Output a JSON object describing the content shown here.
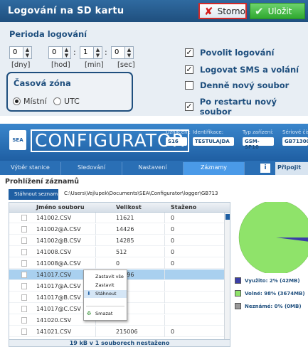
{
  "dialog": {
    "title": "Logování na SD kartu",
    "cancel_label": "Storno",
    "save_label": "Uložit",
    "period_label": "Perioda logování",
    "spinners": [
      {
        "value": "0",
        "unit": "[dny]"
      },
      {
        "value": "0",
        "unit": "[hod]"
      },
      {
        "value": "1",
        "unit": "[min]"
      },
      {
        "value": "0",
        "unit": "[sec]"
      }
    ],
    "timezone_label": "Časová zóna",
    "timezone_options": [
      {
        "label": "Místní",
        "selected": true
      },
      {
        "label": "UTC",
        "selected": false
      }
    ],
    "checkboxes": [
      {
        "label": "Povolit logování",
        "checked": true
      },
      {
        "label": "Logovat SMS a volání",
        "checked": true
      },
      {
        "label": "Denně nový soubor",
        "checked": false
      },
      {
        "label": "Po restartu nový soubor",
        "checked": true
      }
    ],
    "colors": {
      "header": "#2f6aa0",
      "accent": "#1f4f7e",
      "cancel_border": "#d12a2a",
      "save_bg": "#2fa82f"
    }
  },
  "configurator": {
    "logo_text": "SEA",
    "brand": "CONFIGURATOR",
    "header_fields": [
      {
        "label": "Označení:",
        "value": "S16"
      },
      {
        "label": "Identifikace:",
        "value": "TESTULAJDA"
      },
      {
        "label": "Typ zařízení:",
        "value": "GSM-SP10"
      },
      {
        "label": "Sériové čís",
        "value": "GB713006"
      }
    ],
    "nav_tabs": [
      {
        "label": "Výběr stanice",
        "active": false
      },
      {
        "label": "Sledování",
        "active": false
      },
      {
        "label": "Nastavení",
        "active": false
      },
      {
        "label": "Záznamy",
        "active": true
      }
    ],
    "info_icon": "i",
    "connect_label": "Připojit",
    "section_title": "Prohlížení záznamů",
    "download_list_label": "Stáhnout seznam",
    "path": "C:\\Users\\Vejlupek\\Documents\\SEA\\Configurator\\logger\\GB713",
    "table": {
      "headers": [
        "Jméno souboru",
        "Velikost",
        "Staženo"
      ],
      "rows": [
        {
          "name": "141002.CSV",
          "size": "11621",
          "downloaded": "0",
          "selected": false
        },
        {
          "name": "141002@A.CSV",
          "size": "14426",
          "downloaded": "0",
          "selected": false
        },
        {
          "name": "141002@B.CSV",
          "size": "14285",
          "downloaded": "0",
          "selected": false
        },
        {
          "name": "141008.CSV",
          "size": "512",
          "downloaded": "0",
          "selected": false
        },
        {
          "name": "141008@A.CSV",
          "size": "0",
          "downloaded": "0",
          "selected": false
        },
        {
          "name": "141017.CSV",
          "size": "18796",
          "downloaded": "",
          "selected": true
        },
        {
          "name": "141017@A.CSV",
          "size": "",
          "downloaded": "",
          "selected": false
        },
        {
          "name": "141017@B.CSV",
          "size": "",
          "downloaded": "",
          "selected": false
        },
        {
          "name": "141017@C.CSV",
          "size": "",
          "downloaded": "",
          "selected": false
        },
        {
          "name": "141020.CSV",
          "size": "",
          "downloaded": "",
          "selected": false
        },
        {
          "name": "141021.CSV",
          "size": "215006",
          "downloaded": "0",
          "selected": false
        }
      ]
    },
    "status_text": "19 kB v 1 souborech nestaženo",
    "context_menu": [
      {
        "label": "Zastavit vše",
        "icon": "",
        "highlighted": false
      },
      {
        "label": "Zastavit",
        "icon": "",
        "highlighted": false
      },
      {
        "label": "Stáhnout",
        "icon": "download-icon",
        "highlighted": true
      },
      {
        "label": "Smazat",
        "icon": "delete-icon",
        "highlighted": false
      }
    ],
    "pie": {
      "used_fraction": 0.02,
      "free_fraction": 0.98,
      "colors": {
        "used": "#3b3fa8",
        "free": "#8fe36a",
        "unknown": "#999999"
      }
    },
    "legend": [
      {
        "label": "Využito: 2% (42MB)",
        "color": "#3b3fa8"
      },
      {
        "label": "Volné: 98% (3674MB)",
        "color": "#8fe36a"
      },
      {
        "label": "Neznámé: 0% (0MB)",
        "color": "#999999"
      }
    ]
  }
}
